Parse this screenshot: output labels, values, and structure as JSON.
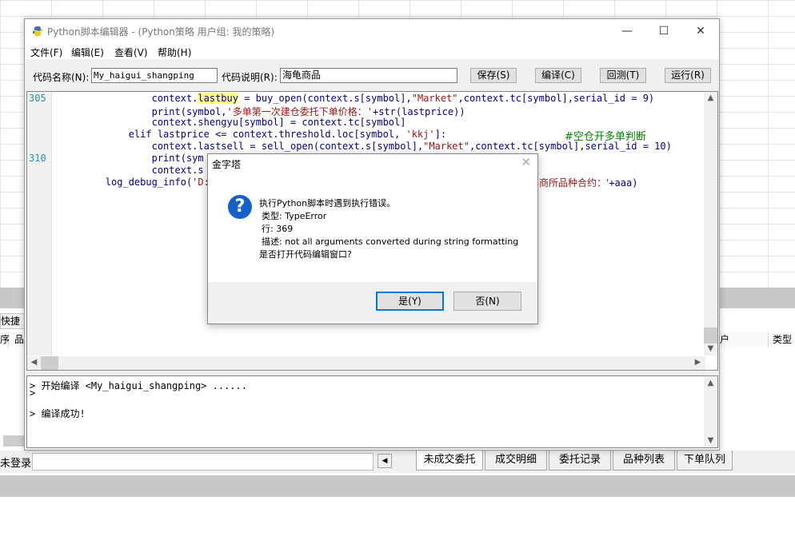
{
  "window": {
    "title": "Python脚本编辑器 - (Python策略 用户组: 我的策略)",
    "controls": {
      "minimize": "—",
      "maximize": "☐",
      "close": "✕"
    }
  },
  "menu": [
    "文件(F)",
    "编辑(E)",
    "查看(V)",
    "帮助(H)"
  ],
  "toolbar": {
    "code_name_label": "代码名称(N):",
    "code_name_value": "My_haigui_shangping",
    "code_desc_label": "代码说明(R):",
    "code_desc_value": "海龟商品",
    "buttons": [
      "保存(S)",
      "编译(C)",
      "回测(T)",
      "运行(R)"
    ]
  },
  "editor": {
    "line_numbers": [
      "305",
      "310"
    ],
    "lines": [
      {
        "pre": "                context.",
        "hl": "lastbuy",
        "mid": " = buy_open(context.s[symbol],",
        "str": "\"Market\"",
        "post": ",context.tc[symbol],serial_id = 9)",
        "cmt": ""
      },
      {
        "pre": "                print(symbol,",
        "hl": "",
        "mid": "",
        "str": "'多单第一次建仓委托下单价格：'",
        "post": "+str(lastprice))",
        "cmt": ""
      },
      {
        "pre": "                context.shengyu[symbol] = context.tc[symbol]",
        "hl": "",
        "mid": "",
        "str": "",
        "post": "",
        "cmt": ""
      },
      {
        "pre": "            elif lastprice <= context.threshold.loc[symbol, ",
        "hl": "",
        "mid": "",
        "str": "'kkj'",
        "post": "]:",
        "cmt": "#空仓开多单判断"
      },
      {
        "pre": "                context.lastsell = ",
        "hl": "",
        "mid": "sell_open(context.s[symbol],",
        "str": "\"Market\"",
        "post": ",context.tc[symbol],serial_id = 10)",
        "cmt": ""
      },
      {
        "pre": "                print(sym",
        "hl": "",
        "mid": "",
        "str": "",
        "post": "",
        "cmt": ""
      },
      {
        "pre": "                context.s",
        "hl": "",
        "mid": "",
        "str": "",
        "post": "",
        "cmt": ""
      },
      {
        "pre": "        log_debug_info(",
        "hl": "",
        "mid": "",
        "str": "'D:\\ha",
        "post": "",
        "cmt": ""
      }
    ],
    "line7_tail_str": "部商所品种合约：'",
    "line7_tail_post": "+aaa)"
  },
  "output": {
    "lines": [
      "> 开始编译 <My_haigui_shangping> ......",
      ">",
      "",
      "> 编译成功!"
    ]
  },
  "dialog": {
    "title": "金字塔",
    "icon": "?",
    "heading": "执行Python脚本时遇到执行错误。",
    "type_line": "类型: TypeError",
    "row_line": "行:  369",
    "desc_line": "描述: not all arguments converted during string formatting",
    "question": "是否打开代码编辑窗口?",
    "yes": "是(Y)",
    "no": "否(N)"
  },
  "background": {
    "toolbar_text": "快捷",
    "col_left_1": "序",
    "col_left_2": "品",
    "col_right_1": "户",
    "col_right_2": "类型",
    "status_text": "未登录",
    "tabs": [
      "未成交委托",
      "成交明细",
      "委托记录",
      "品种列表",
      "下单队列"
    ]
  }
}
